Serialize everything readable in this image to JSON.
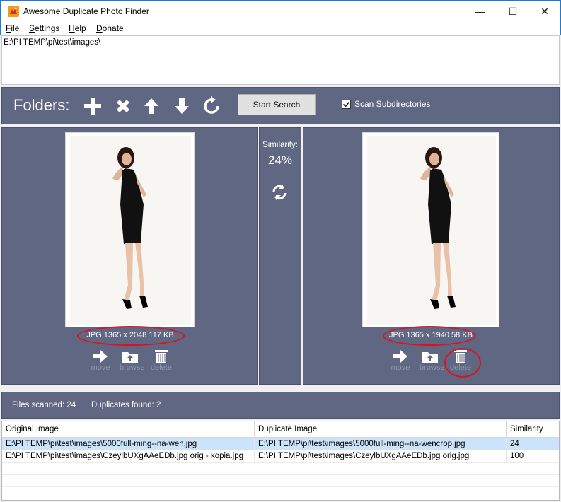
{
  "window": {
    "title": "Awesome Duplicate Photo Finder",
    "minimize": "—",
    "maximize": "☐",
    "close": "✕"
  },
  "menu": [
    {
      "label": "File",
      "u": "F",
      "rest": "ile"
    },
    {
      "label": "Settings",
      "u": "S",
      "rest": "ettings"
    },
    {
      "label": "Help",
      "u": "H",
      "rest": "elp"
    },
    {
      "label": "Donate",
      "u": "D",
      "rest": "onate"
    }
  ],
  "folders": {
    "path": "E:\\PI TEMP\\pi\\test\\images\\"
  },
  "toolbar": {
    "label": "Folders:",
    "add_icon": "plus-icon",
    "remove_icon": "x-icon",
    "up_icon": "arrow-up-icon",
    "down_icon": "arrow-down-icon",
    "reset_icon": "refresh-icon",
    "start_button": "Start Search",
    "scan_subdirectories": {
      "label": "Scan Subdirectories",
      "checked": true
    }
  },
  "original": {
    "info": "JPG  1365 x 2048  117 KB",
    "actions": {
      "move": "move",
      "browse": "browse",
      "delete": "delete"
    }
  },
  "comparison": {
    "label": "Similarity:",
    "value": "24%",
    "swap_icon": "swap-icon"
  },
  "duplicate": {
    "info": "JPG  1365 x 1940  58 KB",
    "actions": {
      "move": "move",
      "browse": "browse",
      "delete": "delete"
    }
  },
  "status": {
    "files_scanned": "Files scanned: 24",
    "duplicates_found": "Duplicates found: 2"
  },
  "results": {
    "columns": [
      "Original Image",
      "Duplicate Image",
      "Similarity"
    ],
    "rows": [
      [
        "E:\\PI TEMP\\pi\\test\\images\\5000full-ming--na-wen.jpg",
        "E:\\PI TEMP\\pi\\test\\images\\5000full-ming--na-wencrop.jpg",
        "24"
      ],
      [
        "E:\\PI TEMP\\pi\\test\\images\\CzeylbUXgAAeEDb.jpg orig - kopia.jpg",
        "E:\\PI TEMP\\pi\\test\\images\\CzeylbUXgAAeEDb.jpg orig.jpg",
        "100"
      ]
    ]
  },
  "colors": {
    "panel": "#5f6783",
    "highlight": "#e0101a",
    "selection": "#cce4fb"
  }
}
